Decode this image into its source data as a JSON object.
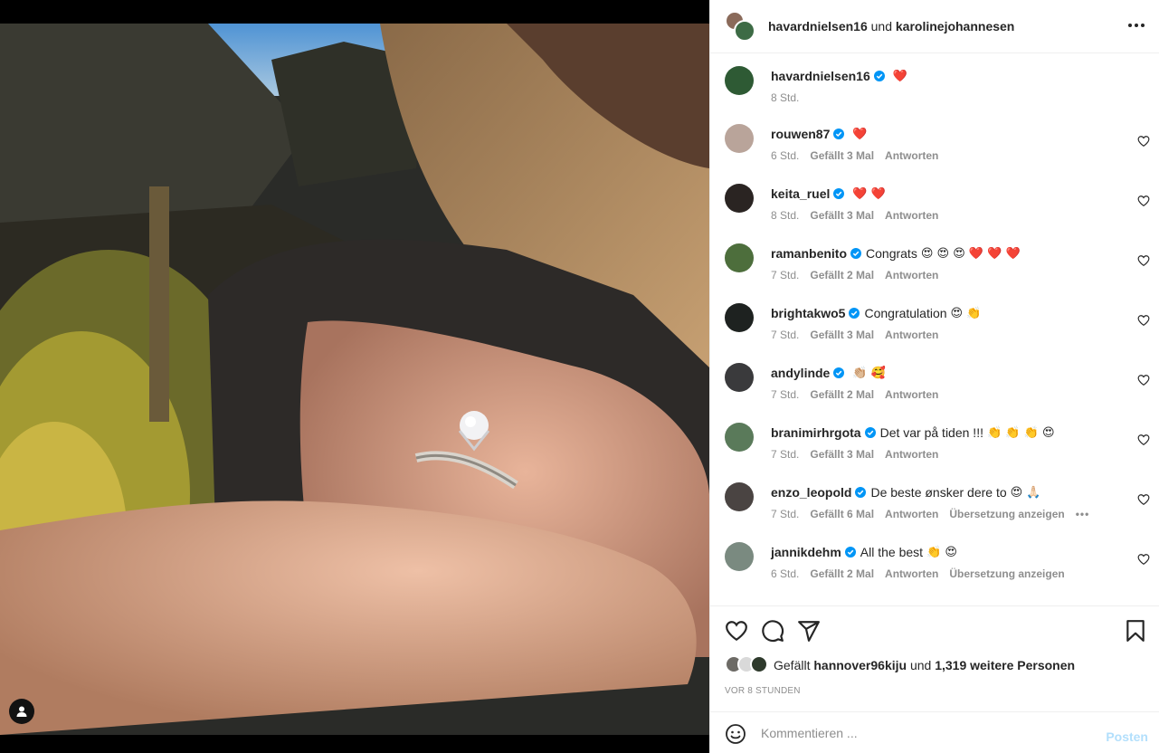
{
  "colors": {
    "link_blue": "#0095f6",
    "post_disabled": "#b2dffc",
    "heart_red": "#ed4956",
    "secondary_text": "#8e8e8e",
    "divider": "#efefef"
  },
  "header": {
    "user1": "havardnielsen16",
    "joiner": "und",
    "user2": "karolinejohannesen",
    "more_icon": "more-horizontal-icon"
  },
  "caption": {
    "username": "havardnielsen16",
    "text": "",
    "emoji": "❤️",
    "time": "8 Std."
  },
  "comments": [
    {
      "username": "rouwen87",
      "text": "",
      "emoji": "❤️",
      "time": "6 Std.",
      "likes": "Gefällt 3 Mal",
      "reply": "Antworten",
      "translate": "",
      "more": ""
    },
    {
      "username": "keita_ruel",
      "text": "",
      "emoji": "❤️ ❤️",
      "time": "8 Std.",
      "likes": "Gefällt 3 Mal",
      "reply": "Antworten",
      "translate": "",
      "more": ""
    },
    {
      "username": "ramanbenito",
      "text": "Congrats",
      "emoji": "😍 😍 😍 ❤️ ❤️ ❤️",
      "time": "7 Std.",
      "likes": "Gefällt 2 Mal",
      "reply": "Antworten",
      "translate": "",
      "more": ""
    },
    {
      "username": "brightakwo5",
      "text": "Congratulation",
      "emoji": "😍 👏",
      "time": "7 Std.",
      "likes": "Gefällt 3 Mal",
      "reply": "Antworten",
      "translate": "",
      "more": ""
    },
    {
      "username": "andylinde",
      "text": "",
      "emoji": "👏🏼 🥰",
      "time": "7 Std.",
      "likes": "Gefällt 2 Mal",
      "reply": "Antworten",
      "translate": "",
      "more": ""
    },
    {
      "username": "branimirhrgota",
      "text": "Det var på tiden !!!",
      "emoji": "👏 👏 👏 😍",
      "time": "7 Std.",
      "likes": "Gefällt 3 Mal",
      "reply": "Antworten",
      "translate": "",
      "more": ""
    },
    {
      "username": "enzo_leopold",
      "text": "De beste ønsker dere to",
      "emoji": "😍 🙏🏻",
      "time": "7 Std.",
      "likes": "Gefällt 6 Mal",
      "reply": "Antworten",
      "translate": "Übersetzung anzeigen",
      "more": "•••"
    },
    {
      "username": "jannikdehm",
      "text": "All the best",
      "emoji": "👏 😍",
      "time": "6 Std.",
      "likes": "Gefällt 2 Mal",
      "reply": "Antworten",
      "translate": "Übersetzung anzeigen",
      "more": ""
    }
  ],
  "likes": {
    "prefix": "Gefällt",
    "user": "hannover96kiju",
    "joiner": "und",
    "others": "1,319 weitere Personen"
  },
  "time_ago": "VOR 8 STUNDEN",
  "add_comment": {
    "placeholder": "Kommentieren ...",
    "post_label": "Posten"
  }
}
